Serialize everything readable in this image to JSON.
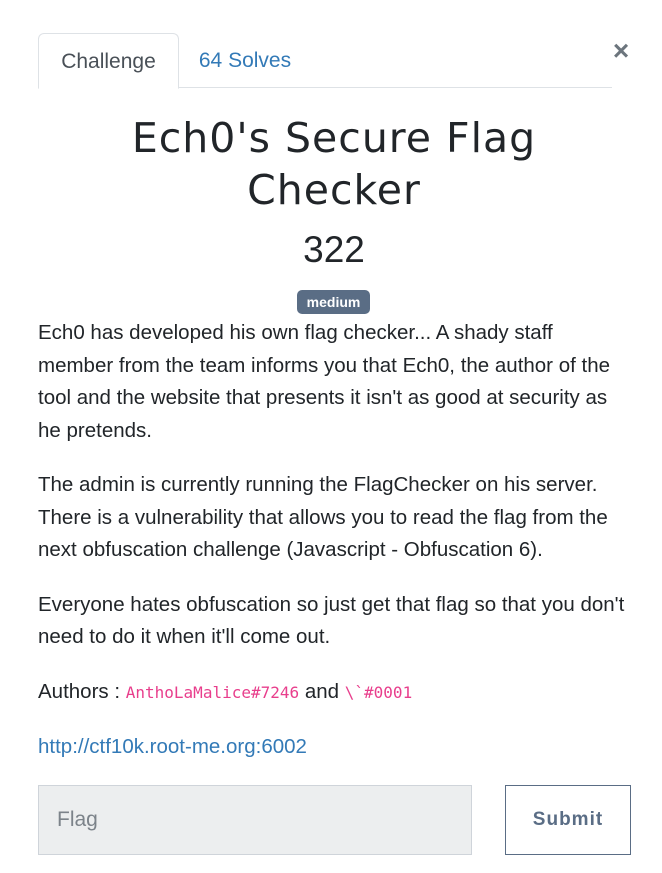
{
  "tabs": {
    "challenge_label": "Challenge",
    "solves_label": "64 Solves"
  },
  "close_icon": "close-icon",
  "challenge": {
    "title": "Ech0's Secure Flag Checker",
    "points": "322",
    "difficulty": "medium",
    "description": [
      "Ech0 has developed his own flag checker... A shady staff member from the team informs you that Ech0, the author of the tool and the website that presents it isn't as good at security as he pretends.",
      "The admin is currently running the FlagChecker on his server. There is a vulnerability that allows you to read the flag from the next obfuscation challenge (Javascript - Obfuscation 6).",
      "Everyone hates obfuscation so just get that flag so that you don't need to do it when it'll come out."
    ],
    "authors_label": "Authors :",
    "author_1": "AnthoLaMalice#7246",
    "authors_and": "and",
    "author_2": "\\`#0001",
    "link": "http://ctf10k.root-me.org:6002"
  },
  "form": {
    "flag_placeholder": "Flag",
    "flag_value": "",
    "submit_label": "Submit"
  },
  "colors": {
    "link": "#337ab7",
    "badge": "#5a6d85",
    "code": "#e83e8c"
  }
}
